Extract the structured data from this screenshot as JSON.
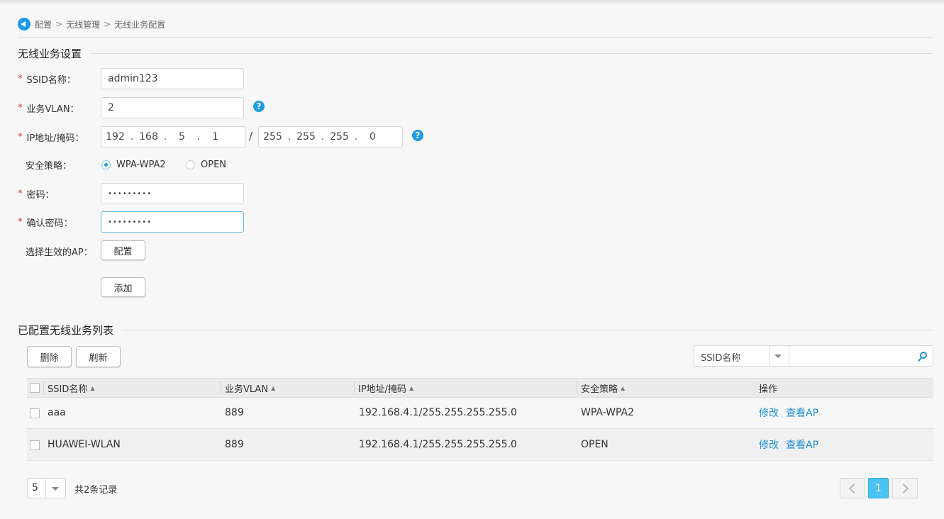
{
  "breadcrumb": [
    "配置",
    "无线管理",
    "无线业务配置"
  ],
  "breadcrumb_sep": ">",
  "form": {
    "section_title": "无线业务设置",
    "required_mark": "*",
    "ssid": {
      "label": "SSID名称：",
      "value": "admin123"
    },
    "vlan": {
      "label": "业务VLAN：",
      "value": "2"
    },
    "ip": {
      "label": "IP地址/掩码：",
      "address": [
        "192",
        "168",
        "5",
        "1"
      ],
      "mask": [
        "255",
        "255",
        "255",
        "0"
      ],
      "dot": ".",
      "slash": "/"
    },
    "security": {
      "label": "安全策略：",
      "options": [
        "WPA-WPA2",
        "OPEN"
      ],
      "selected": "WPA-WPA2"
    },
    "password": {
      "label": "密码：",
      "value": "•••••••••"
    },
    "confirm_password": {
      "label": "确认密码：",
      "value": "•••••••••"
    },
    "ap": {
      "label": "选择生效的AP：",
      "button": "配置"
    },
    "add_button": "添加",
    "help_glyph": "?"
  },
  "list": {
    "section_title": "已配置无线业务列表",
    "delete_button": "删除",
    "refresh_button": "刷新",
    "search_field": "SSID名称",
    "search_value": "",
    "columns": [
      "SSID名称",
      "业务VLAN",
      "IP地址/掩码",
      "安全策略",
      "操作"
    ],
    "sort_glyph": "▲",
    "rows": [
      {
        "ssid": "aaa",
        "vlan": "889",
        "ip": "192.168.4.1/255.255.255.255.0",
        "security": "WPA-WPA2",
        "actions": [
          "修改",
          "查看AP"
        ]
      },
      {
        "ssid": "HUAWEI-WLAN",
        "vlan": "889",
        "ip": "192.168.4.1/255.255.255.255.0",
        "security": "OPEN",
        "actions": [
          "修改",
          "查看AP"
        ]
      }
    ]
  },
  "pagination": {
    "page_size": "5",
    "total_text": "共2条记录",
    "current_page": "1"
  },
  "colors": {
    "accent": "#1e9be6",
    "required": "#e23333",
    "link": "#1e8fd6",
    "active_page": "#4cc3f2"
  }
}
